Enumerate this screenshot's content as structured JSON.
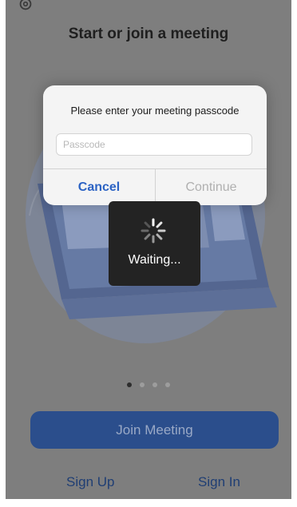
{
  "header": {
    "title": "Start or join a meeting",
    "settings_icon": "gear-icon"
  },
  "pager": {
    "count": 4,
    "active_index": 0
  },
  "buttons": {
    "join_meeting": "Join Meeting",
    "sign_up": "Sign Up",
    "sign_in": "Sign In"
  },
  "dialog": {
    "message": "Please enter your meeting passcode",
    "passcode_placeholder": "Passcode",
    "passcode_value": "",
    "cancel_label": "Cancel",
    "continue_label": "Continue"
  },
  "loading": {
    "label": "Waiting...",
    "icon": "spinner-icon"
  },
  "colors": {
    "accent_blue": "#2c63c4",
    "join_button": "#2b4e8c",
    "overlay": "#7e7e7e"
  }
}
